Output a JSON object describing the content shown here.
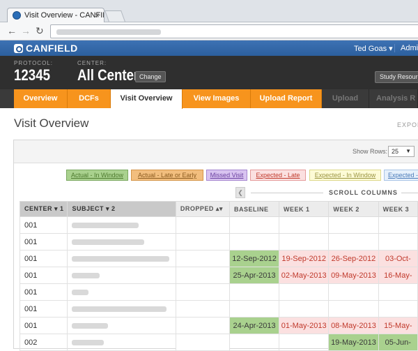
{
  "browser": {
    "tab_title": "Visit Overview - CANFIELD",
    "close_glyph": "×"
  },
  "app": {
    "brand": "CANFIELD",
    "user_name": "Ted Goas",
    "user_caret": "▾",
    "admin_label": "Admi"
  },
  "header": {
    "protocol_label": "PROTOCOL:",
    "protocol_value": "12345",
    "center_label": "CENTER:",
    "center_value": "All Centers",
    "change_label": "Change",
    "study_resources_label": "Study Resourc"
  },
  "nav": {
    "tabs": [
      {
        "label": "Overview",
        "state": "normal"
      },
      {
        "label": "DCFs",
        "state": "normal"
      },
      {
        "label": "Visit Overview",
        "state": "active"
      },
      {
        "label": "View Images",
        "state": "normal"
      },
      {
        "label": "Upload Report",
        "state": "normal"
      },
      {
        "label": "Upload",
        "state": "disabled"
      },
      {
        "label": "Analysis R",
        "state": "disabled"
      }
    ]
  },
  "page": {
    "title": "Visit Overview",
    "export_label": "EXPOR",
    "show_rows_label": "Show Rows:",
    "show_rows_value": "25",
    "scroll_columns_label": "SCROLL COLUMNS"
  },
  "legend": [
    {
      "label": "Actual - In Window",
      "bg": "#a9d18e",
      "border": "#7aa860",
      "color": "#4d7a2e"
    },
    {
      "label": "Actual - Late or Early",
      "bg": "#f2be7e",
      "border": "#d49448",
      "color": "#8a5a1e"
    },
    {
      "label": "Missed Visit",
      "bg": "#d8c3f0",
      "border": "#a585cf",
      "color": "#6a3fa0"
    },
    {
      "label": "Expected - Late",
      "bg": "#fbe0e0",
      "border": "#e59a9a",
      "color": "#c0392b"
    },
    {
      "label": "Expected - In Window",
      "bg": "#fdfbd6",
      "border": "#ddd88a",
      "color": "#9a9440"
    },
    {
      "label": "Expected - ",
      "bg": "#e6f0fb",
      "border": "#a9c4e6",
      "color": "#4a7ab8"
    }
  ],
  "table": {
    "headers": [
      {
        "label": "CENTER",
        "sort": "▾ 1"
      },
      {
        "label": "SUBJECT",
        "sort": "▾ 2"
      },
      {
        "label": "DROPPED",
        "sort": "▴▾"
      },
      {
        "label": "BASELINE",
        "sort": ""
      },
      {
        "label": "WEEK 1",
        "sort": ""
      },
      {
        "label": "WEEK 2",
        "sort": ""
      },
      {
        "label": "WEEK 3",
        "sort": ""
      }
    ],
    "rows": [
      {
        "center": "001",
        "baseline": "",
        "week1": "",
        "week2": "",
        "week3": ""
      },
      {
        "center": "001",
        "baseline": "",
        "week1": "",
        "week2": "",
        "week3": ""
      },
      {
        "center": "001",
        "baseline": "12-Sep-2012",
        "week1": "19-Sep-2012",
        "week2": "26-Sep-2012",
        "week3": "03-Oct-"
      },
      {
        "center": "001",
        "baseline": "25-Apr-2013",
        "week1": "02-May-2013",
        "week2": "09-May-2013",
        "week3": "16-May-"
      },
      {
        "center": "001",
        "baseline": "",
        "week1": "",
        "week2": "",
        "week3": ""
      },
      {
        "center": "001",
        "baseline": "",
        "week1": "",
        "week2": "",
        "week3": ""
      },
      {
        "center": "001",
        "baseline": "24-Apr-2013",
        "week1": "01-May-2013",
        "week2": "08-May-2013",
        "week3": "15-May-"
      },
      {
        "center": "002",
        "baseline": "",
        "week1": "",
        "week2": "19-May-2013",
        "week3": "05-Jun-"
      }
    ]
  }
}
